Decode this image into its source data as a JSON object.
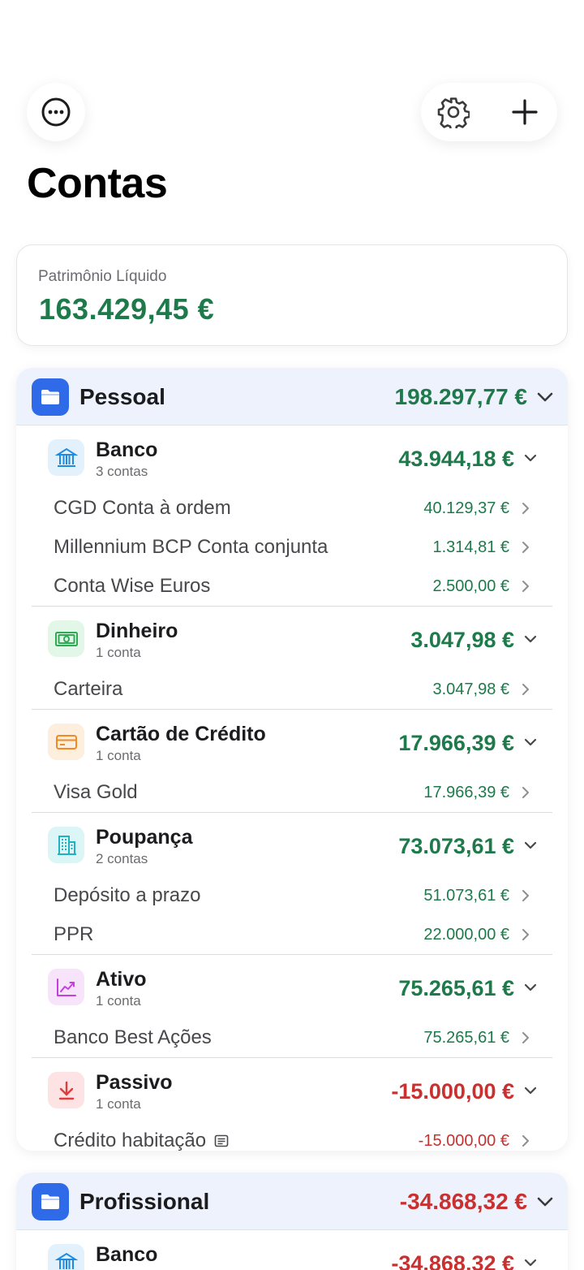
{
  "header": {
    "title": "Contas",
    "more_icon": "ellipsis-circle-icon",
    "settings_icon": "gear-icon",
    "add_icon": "plus-icon"
  },
  "networth": {
    "label": "Patrimônio Líquido",
    "value": "163.429,45 €"
  },
  "colors": {
    "positive": "#1e7a4a",
    "negative": "#c8312f",
    "folder": "#2f6be8",
    "group_header_bg": "#eef2fc"
  },
  "groups": [
    {
      "name": "Pessoal",
      "total": "198.297,77 €",
      "categories": [
        {
          "name": "Banco",
          "count": "3 contas",
          "total": "43.944,18 €",
          "icon": "bank-icon",
          "accounts": [
            {
              "name": "CGD Conta à ordem",
              "value": "40.129,37 €"
            },
            {
              "name": "Millennium BCP Conta conjunta",
              "value": "1.314,81 €"
            },
            {
              "name": "Conta Wise Euros",
              "value": "2.500,00 €"
            }
          ]
        },
        {
          "name": "Dinheiro",
          "count": "1 conta",
          "total": "3.047,98 €",
          "icon": "banknote-icon",
          "accounts": [
            {
              "name": "Carteira",
              "value": "3.047,98 €"
            }
          ]
        },
        {
          "name": "Cartão de Crédito",
          "count": "1 conta",
          "total": "17.966,39 €",
          "icon": "credit-card-icon",
          "accounts": [
            {
              "name": "Visa Gold",
              "value": "17.966,39 €"
            }
          ]
        },
        {
          "name": "Poupança",
          "count": "2 contas",
          "total": "73.073,61 €",
          "icon": "building-icon",
          "accounts": [
            {
              "name": "Depósito a prazo",
              "value": "51.073,61 €"
            },
            {
              "name": "PPR",
              "value": "22.000,00 €"
            }
          ]
        },
        {
          "name": "Ativo",
          "count": "1 conta",
          "total": "75.265,61 €",
          "icon": "trend-chart-icon",
          "accounts": [
            {
              "name": "Banco Best Ações",
              "value": "75.265,61 €"
            }
          ]
        },
        {
          "name": "Passivo",
          "count": "1 conta",
          "total": "-15.000,00 €",
          "icon": "arrow-down-icon",
          "accounts": [
            {
              "name": "Crédito habitação",
              "value": "-15.000,00 €",
              "note_icon": "note-icon"
            }
          ]
        }
      ]
    },
    {
      "name": "Profissional",
      "total": "-34.868,32 €",
      "categories": [
        {
          "name": "Banco",
          "total": "-34.868,32 €",
          "icon": "bank-icon"
        }
      ]
    }
  ]
}
